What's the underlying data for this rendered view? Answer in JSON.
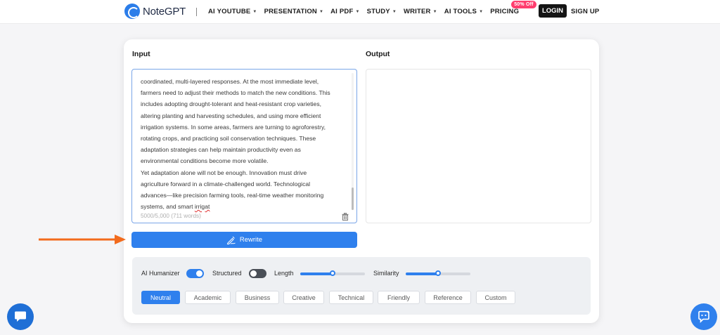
{
  "header": {
    "brand": "NoteGPT",
    "nav": [
      {
        "label": "AI YOUTUBE",
        "dropdown": true
      },
      {
        "label": "PRESENTATION",
        "dropdown": true
      },
      {
        "label": "AI PDF",
        "dropdown": true
      },
      {
        "label": "STUDY",
        "dropdown": true
      },
      {
        "label": "WRITER",
        "dropdown": true
      },
      {
        "label": "AI TOOLS",
        "dropdown": true
      },
      {
        "label": "PRICING",
        "dropdown": false
      }
    ],
    "promo_badge": "50% Off",
    "login_label": "LOGIN",
    "signup_label": "SIGN UP"
  },
  "editor": {
    "input_title": "Input",
    "output_title": "Output",
    "input_text_main": "coordinated, multi-layered responses. At the most immediate level,\nfarmers need to adjust their methods to match the new conditions. This\nincludes adopting drought-tolerant and heat-resistant crop varieties,\naltering planting and harvesting schedules, and using more efficient\nirrigation systems. In some areas, farmers are turning to agroforestry,\nrotating crops, and practicing soil conservation techniques. These\nadaptation strategies can help maintain productivity even as\nenvironmental conditions become more volatile.\nYet adaptation alone will not be enough. Innovation must drive\nagriculture forward in a climate-challenged world. Technological\nadvances—like precision farming tools, real-time weather monitoring\nsystems, and smart ",
    "input_text_typo": "irrigat",
    "char_count": "5000/5,000 (711 words)",
    "rewrite_label": "Rewrite",
    "output_text": ""
  },
  "options": {
    "humanizer_label": "AI Humanizer",
    "humanizer_on": true,
    "structured_label": "Structured",
    "structured_on": false,
    "length_label": "Length",
    "length_value": 0.5,
    "similarity_label": "Similarity",
    "similarity_value": 0.5,
    "tones": [
      "Neutral",
      "Academic",
      "Business",
      "Creative",
      "Technical",
      "Friendly",
      "Reference",
      "Custom"
    ],
    "selected_tone": "Neutral"
  },
  "colors": {
    "accent": "#2f80ed",
    "arrow": "#f26b1d",
    "promo": "#ff3d6e",
    "login_bg": "#151515"
  },
  "icons": {
    "logo": "notegpt-logo-icon",
    "trash": "trash-icon",
    "rewrite": "magic-pen-icon",
    "chat": "chat-bubble-icon",
    "assistant": "assistant-chat-icon",
    "arrow": "arrow-right-icon"
  }
}
